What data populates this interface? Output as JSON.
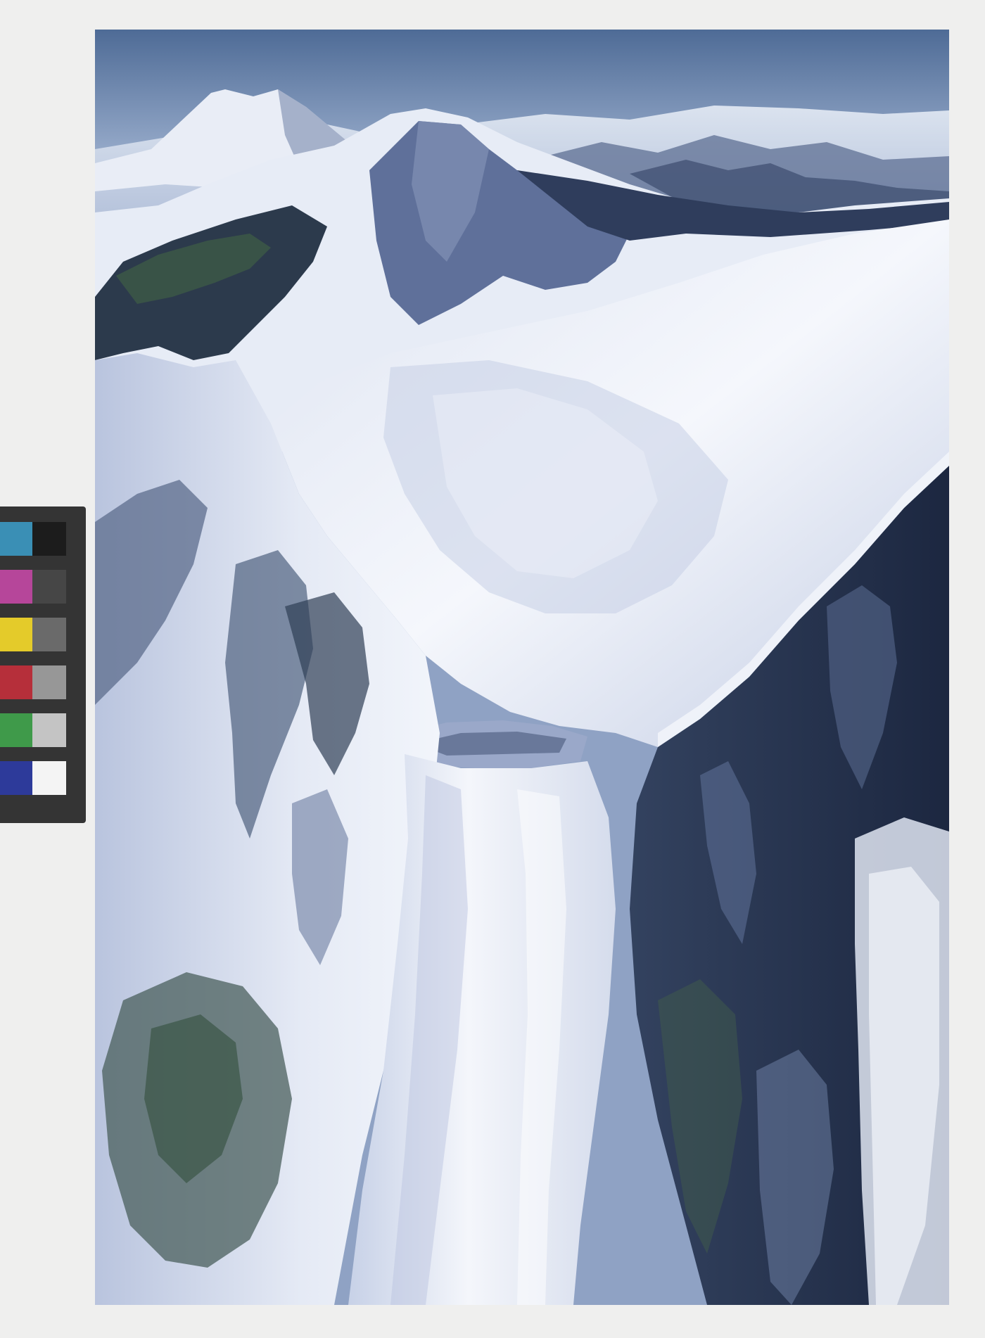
{
  "image": {
    "subject": "aerial-photo-snowy-mountain-glacier"
  },
  "colors": {
    "background": "#efefee",
    "sky_top": "#4e6b96",
    "sky_bottom": "#94a9c9",
    "snow_light": "#f4f6fb",
    "snow_shadow": "#aeb9d6",
    "rock_dark": "#1b2740",
    "rock_green": "#2f4a3c"
  },
  "color_card": {
    "swatches": [
      {
        "name": "cyan",
        "color": "#3a8fb5"
      },
      {
        "name": "magenta",
        "color": "#b6469a"
      },
      {
        "name": "yellow",
        "color": "#e4cb2a"
      },
      {
        "name": "red",
        "color": "#b62f3a"
      },
      {
        "name": "green",
        "color": "#3f9a4a"
      },
      {
        "name": "blue",
        "color": "#2d3a9a"
      },
      {
        "name": "black",
        "color": "#1c1c1c"
      },
      {
        "name": "gray-1",
        "color": "#464646"
      },
      {
        "name": "gray-2",
        "color": "#6a6a6a"
      },
      {
        "name": "gray-3",
        "color": "#979797"
      },
      {
        "name": "gray-4",
        "color": "#c4c4c4"
      },
      {
        "name": "white",
        "color": "#f4f4f4"
      }
    ]
  }
}
